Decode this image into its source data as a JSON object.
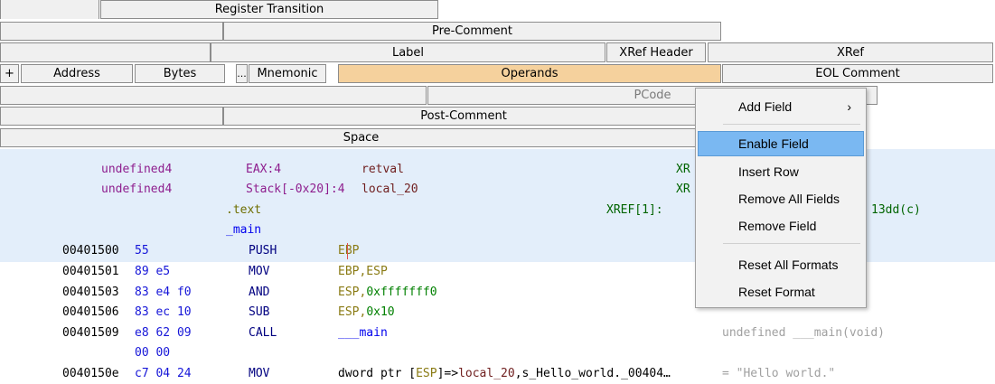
{
  "header": {
    "register_transition": "Register Transition",
    "pre_comment": "Pre-Comment",
    "label": "Label",
    "xref_header": "XRef Header",
    "xref": "XRef",
    "plus": "+",
    "address": "Address",
    "bytes": "Bytes",
    "ellipsis": "...",
    "mnemonic": "Mnemonic",
    "operands": "Operands",
    "eol_comment": "EOL Comment",
    "pcode": "PCode",
    "post_comment": "Post-Comment",
    "space": "Space"
  },
  "listing": {
    "var1": {
      "type": "undefined4",
      "storage": "EAX:4",
      "name": "retval",
      "xref": "XR"
    },
    "var2": {
      "type": "undefined4",
      "storage": "Stack[-0x20]:4",
      "name": "local_20",
      "xref": "XR"
    },
    "section": ".text",
    "func_xref": "XREF[1]:",
    "func_xref_target": "13dd(c)",
    "label": "_main",
    "rows": [
      {
        "addr": "00401500",
        "bytes": "55",
        "mnem": "PUSH",
        "op": "EBP"
      },
      {
        "addr": "00401501",
        "bytes": "89 e5",
        "mnem": "MOV",
        "op": "EBP,ESP"
      },
      {
        "addr": "00401503",
        "bytes": "83 e4 f0",
        "mnem": "AND",
        "op_reg": "ESP,",
        "op_num": "0xfffffff0"
      },
      {
        "addr": "00401506",
        "bytes": "83 ec 10",
        "mnem": "SUB",
        "op_reg": "ESP,",
        "op_num": "0x10"
      },
      {
        "addr": "00401509",
        "bytes": "e8 62 09",
        "bytes2": "00 00",
        "mnem": "CALL",
        "op": "___main",
        "comment": "undefined ___main(void)"
      },
      {
        "addr": "0040150e",
        "bytes": "c7 04 24",
        "mnem": "MOV",
        "op_a": "dword ptr [",
        "op_b": "ESP",
        "op_c": "]=>",
        "op_d": "local_20",
        "op_e": ",s_Hello_world._00404…",
        "comment": "= \"Hello world.\""
      }
    ]
  },
  "menu": {
    "add_field": "Add Field",
    "add_field_arrow": "›",
    "enable_field": "Enable Field",
    "insert_row": "Insert Row",
    "remove_all_fields": "Remove All Fields",
    "remove_field": "Remove Field",
    "reset_all_formats": "Reset All Formats",
    "reset_format": "Reset Format"
  }
}
